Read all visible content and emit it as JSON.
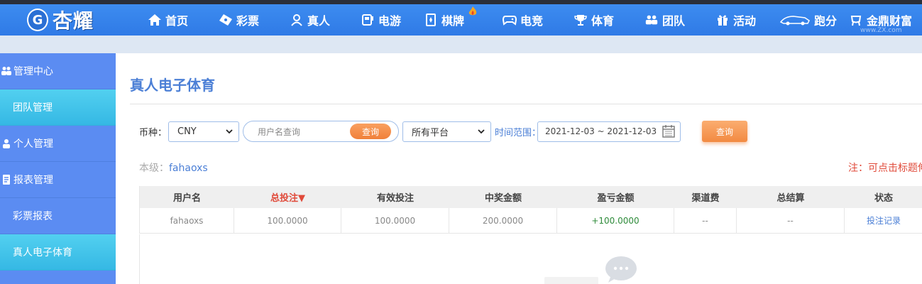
{
  "app": {
    "logo_text": "杏耀",
    "logo_badge": "G",
    "watermark": "www.ZX.com"
  },
  "nav": {
    "items": [
      {
        "label": "首页",
        "icon": "home-icon"
      },
      {
        "label": "彩票",
        "icon": "ticket-icon"
      },
      {
        "label": "真人",
        "icon": "user-icon"
      },
      {
        "label": "电游",
        "icon": "arcade-icon"
      },
      {
        "label": "棋牌",
        "icon": "card-icon"
      },
      {
        "label": "电竞",
        "icon": "gamepad-icon"
      },
      {
        "label": "体育",
        "icon": "trophy-icon"
      },
      {
        "label": "团队",
        "icon": "team-icon"
      },
      {
        "label": "活动",
        "icon": "gift-icon"
      },
      {
        "label": "跑分",
        "icon": "running-car-icon"
      },
      {
        "label": "金鼎财富",
        "icon": "tripod-icon"
      }
    ]
  },
  "sidebar": {
    "items": [
      {
        "label": "管理中心",
        "type": "group",
        "icon": "users-icon"
      },
      {
        "label": "团队管理",
        "type": "child"
      },
      {
        "label": "个人管理",
        "type": "group",
        "icon": "person-icon"
      },
      {
        "label": "报表管理",
        "type": "group",
        "icon": "report-icon"
      },
      {
        "label": "彩票报表",
        "type": "child"
      },
      {
        "label": "真人电子体育",
        "type": "child-active"
      }
    ]
  },
  "main": {
    "title": "真人电子体育",
    "filters": {
      "currency_label": "币种：",
      "currency_value": "CNY",
      "username_placeholder": "用户名查询",
      "search_button": "查询",
      "platform_value": "所有平台",
      "time_label": "时间范围：",
      "date_range": "2021-12-03 ~ 2021-12-03",
      "query_button": "查询"
    },
    "level_label": "本级：",
    "level_value": "fahaoxs",
    "note": "注：可点击标题伸缩"
  },
  "table": {
    "headers": [
      "用户名",
      "总投注▼",
      "有效投注",
      "中奖金额",
      "盈亏金额",
      "渠道费",
      "总结算",
      "状态"
    ],
    "rows": [
      [
        "fahaoxs",
        "100.0000",
        "100.0000",
        "200.0000",
        "+100.0000",
        "--",
        "--",
        "投注记录"
      ]
    ]
  },
  "colors": {
    "nav_bg": "#3d8cf0",
    "sidebar_bg": "#5b8cf2",
    "sidebar_active": "#45c2ea",
    "accent_orange": "#f28a42",
    "title_blue": "#4b7fd6",
    "note_red": "#e04a3a",
    "profit_green": "#2e8b3a"
  }
}
